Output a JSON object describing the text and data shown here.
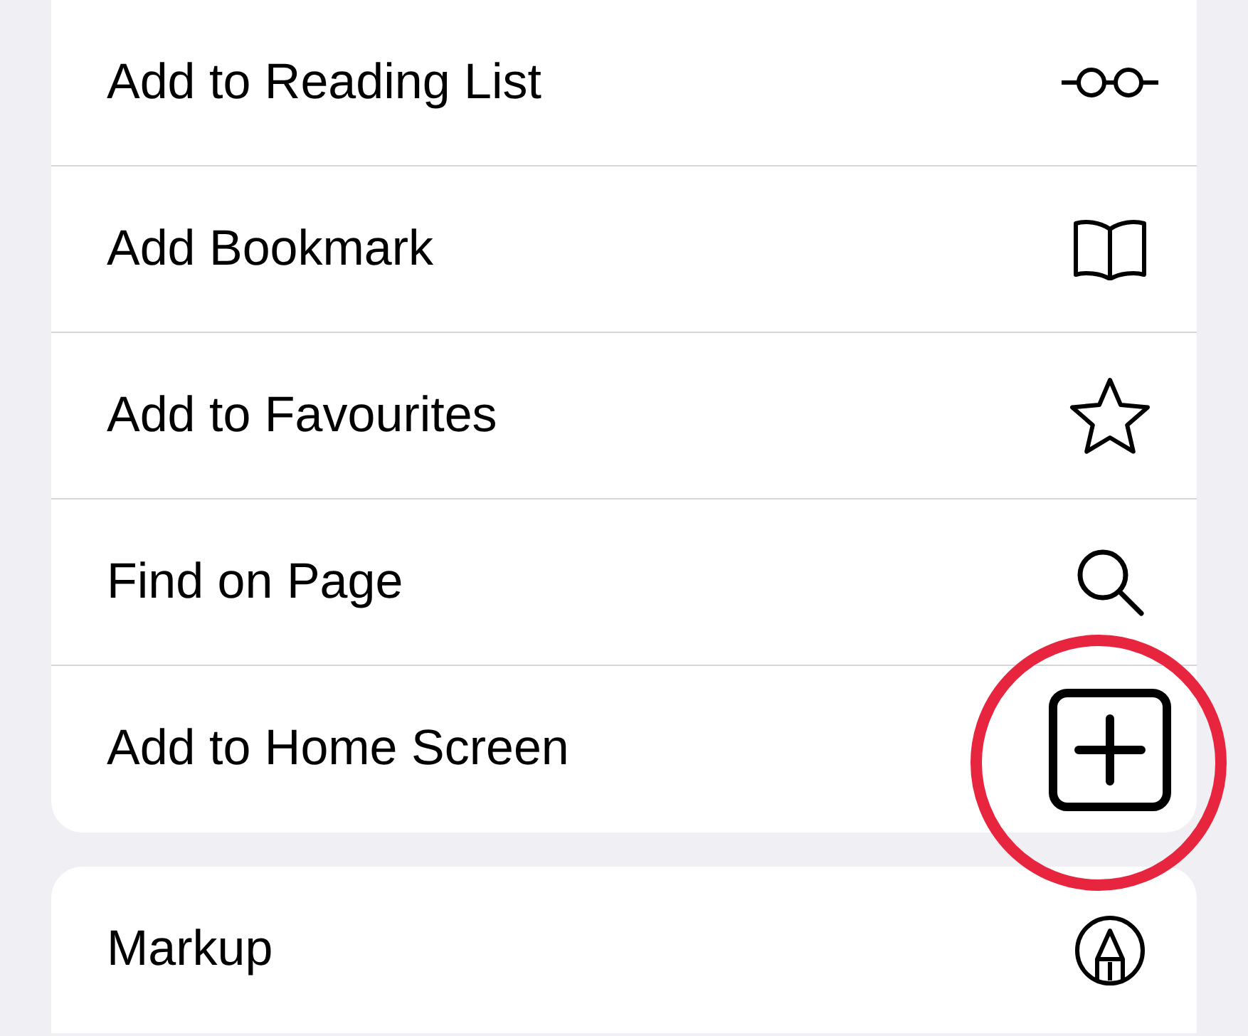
{
  "menu_groups": [
    {
      "items": [
        {
          "label": "Add to Reading List",
          "kind": "glasses",
          "highlighted": false
        },
        {
          "label": "Add Bookmark",
          "kind": "book",
          "highlighted": false
        },
        {
          "label": "Add to Favourites",
          "kind": "star",
          "highlighted": false
        },
        {
          "label": "Find on Page",
          "kind": "search",
          "highlighted": false
        },
        {
          "label": "Add to Home Screen",
          "kind": "plus-square",
          "highlighted": true
        }
      ]
    },
    {
      "items": [
        {
          "label": "Markup",
          "kind": "markup",
          "highlighted": false
        }
      ]
    }
  ]
}
